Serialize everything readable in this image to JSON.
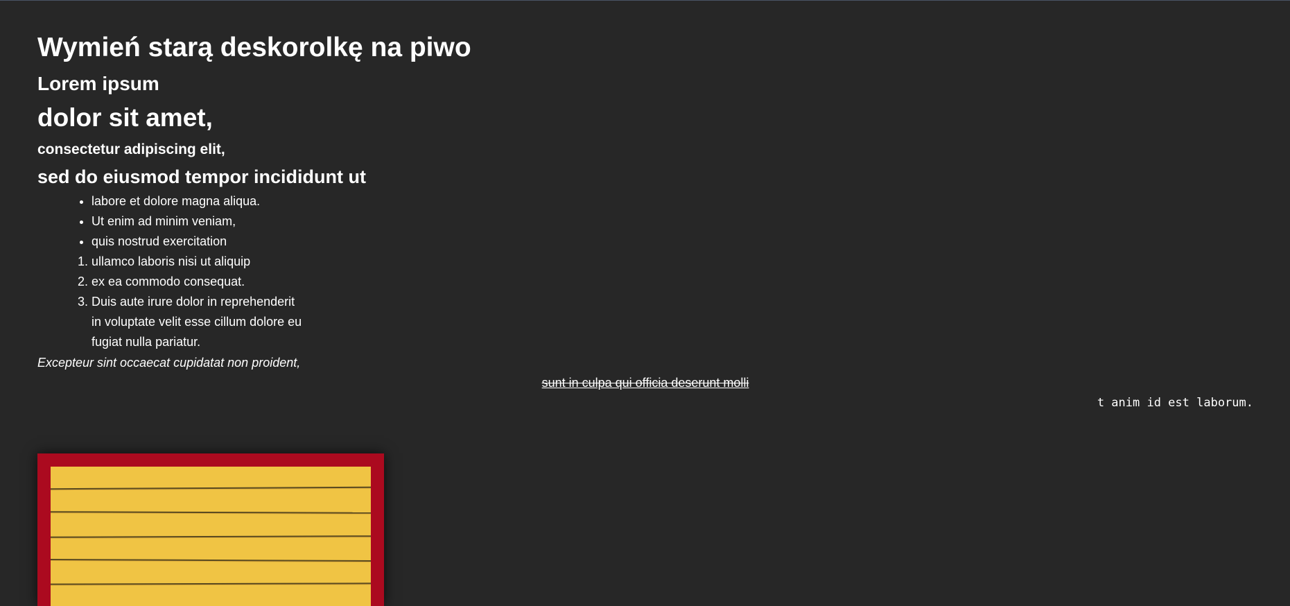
{
  "article": {
    "title": "Wymień starą deskorolkę na piwo",
    "heading_2": "Lorem ipsum",
    "heading_3": "dolor sit amet,",
    "heading_4": "consectetur adipiscing elit,",
    "heading_5": "sed do eiusmod tempor incididunt ut",
    "bullet_items": [
      "labore et dolore magna aliqua.",
      "Ut enim ad minim veniam,",
      "quis nostrud exercitation"
    ],
    "numbered_items": [
      "ullamco laboris nisi ut aliquip",
      "ex ea commodo consequat.",
      "Duis aute irure dolor in reprehenderit",
      "in voluptate velit esse cillum dolore eu",
      "fugiat nulla pariatur."
    ],
    "italic_text": "Excepteur sint occaecat cupidatat non proident,",
    "strikethrough_text": "sunt in culpa qui officia deserunt molli",
    "monospace_text": "t anim id est laborum."
  },
  "image": {
    "frame_color": "#ab0a1f",
    "subject": "yellow wooden planks"
  },
  "colors": {
    "background": "#272727",
    "text": "#ffffff"
  }
}
